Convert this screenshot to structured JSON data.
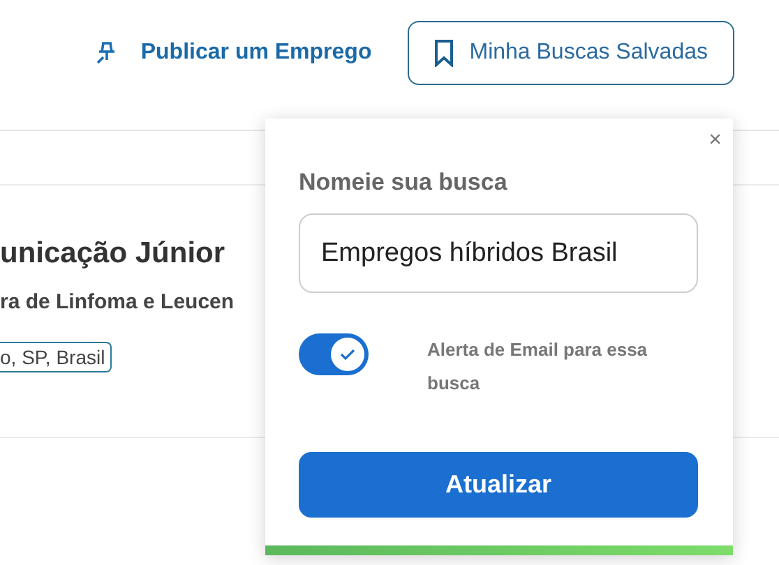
{
  "header": {
    "post_job": "Publicar um Emprego",
    "saved_searches": "Minha Buscas Salvadas"
  },
  "job_card": {
    "title": "unicação Júnior",
    "company": "ra de Linfoma e Leucen",
    "location": "o, SP, Brasil"
  },
  "save_popover": {
    "label": "Nomeie sua busca",
    "value": "Empregos híbridos Brasil",
    "email_alert": {
      "label": "Alerta de Email para essa busca",
      "on": true
    },
    "button": "Atualizar",
    "close": "×"
  }
}
